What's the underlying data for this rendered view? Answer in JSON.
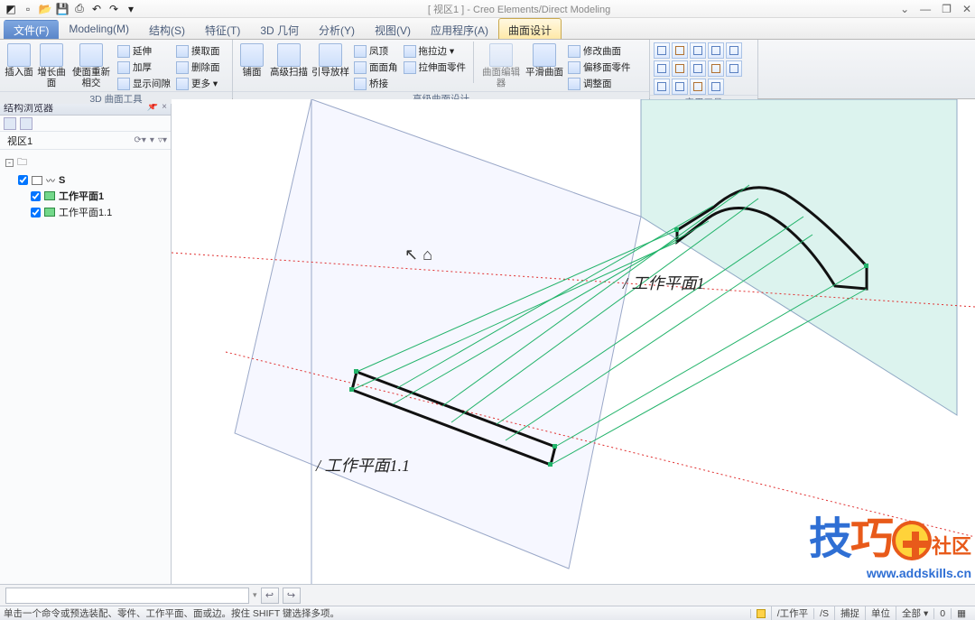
{
  "title": {
    "viewport_tag": "视区1",
    "app": "Creo Elements/Direct Modeling"
  },
  "window_controls": {
    "min": "—",
    "restore": "❐",
    "close": "✕",
    "help": "⌄"
  },
  "menu": {
    "file": "文件(F)",
    "tabs": [
      "Modeling(M)",
      "结构(S)",
      "特征(T)",
      "3D 几何",
      "分析(Y)",
      "视图(V)",
      "应用程序(A)",
      "曲面设计"
    ],
    "active_index": 7
  },
  "ribbon": {
    "groups": [
      {
        "title": "3D 曲面工具",
        "big": [
          {
            "label": "插入面"
          },
          {
            "label": "增长曲面"
          },
          {
            "label": "使面重新相交"
          }
        ],
        "small_cols": [
          [
            {
              "label": "延伸"
            },
            {
              "label": "加厚"
            },
            {
              "label": "显示间隙"
            }
          ],
          [
            {
              "label": "摸取面"
            },
            {
              "label": "删除面"
            },
            {
              "label": "更多 ▾"
            }
          ]
        ]
      },
      {
        "title": "高级曲面设计",
        "big": [
          {
            "label": "铺面"
          },
          {
            "label": "高级扫描"
          },
          {
            "label": "引导放样"
          }
        ],
        "small_cols": [
          [
            {
              "label": "凤顶"
            },
            {
              "label": "面面角"
            },
            {
              "label": "桥接"
            }
          ],
          [
            {
              "label": "拖拉边 ▾"
            },
            {
              "label": "拉伸面零件"
            }
          ]
        ],
        "big2": [
          {
            "label": "曲面编辑器",
            "disabled": true
          },
          {
            "label": "平滑曲面"
          }
        ],
        "small_cols2": [
          [
            {
              "label": "修改曲面"
            },
            {
              "label": "偏移面零件"
            },
            {
              "label": "调整面"
            }
          ]
        ]
      },
      {
        "title": "实用工具",
        "iconrows": 3,
        "icons_per_row": 5
      }
    ]
  },
  "side": {
    "title": "结构浏览器",
    "pin": "📌",
    "close": "×",
    "view_label": "视区1",
    "view_icons": [
      "⟳▾",
      "▾",
      "▿▾"
    ],
    "tree": [
      {
        "level": 0,
        "exp": "-",
        "chk": true,
        "icon": "part",
        "label": "S",
        "bold": true
      },
      {
        "level": 1,
        "chk": true,
        "icon": "wp",
        "label": "工作平面1",
        "bold": true
      },
      {
        "level": 1,
        "chk": true,
        "icon": "wp",
        "label": "工作平面1.1",
        "bold": false
      }
    ]
  },
  "viewport_labels": {
    "wp1": "/ 工作平面1",
    "wp11": "/ 工作平面1.1"
  },
  "watermark": {
    "char1": "技",
    "char2": "巧",
    "tag": "社区",
    "url": "www.addskills.cn"
  },
  "cmd": {
    "placeholder": "",
    "btn_prev": "↩",
    "btn_next": "↪"
  },
  "status": {
    "hint": "单击一个命令或预选装配、零件、工作平面、面或边。按住 SHIFT 键选择多项。",
    "cells": [
      "/工作平",
      "/S",
      "捕捉",
      "单位",
      "全部 ▾",
      "0",
      "▦"
    ]
  }
}
